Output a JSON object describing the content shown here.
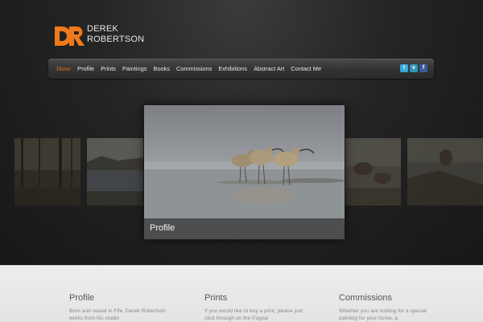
{
  "logo": {
    "line1": "DEREK",
    "line2": "ROBERTSON",
    "mark_color": "#f07a1b"
  },
  "nav": {
    "items": [
      {
        "label": "Home",
        "active": true
      },
      {
        "label": "Profile"
      },
      {
        "label": "Prints"
      },
      {
        "label": "Paintings"
      },
      {
        "label": "Books"
      },
      {
        "label": "Commissions"
      },
      {
        "label": "Exhibitions"
      },
      {
        "label": "Abstract Art"
      },
      {
        "label": "Contact Me"
      }
    ],
    "social": [
      {
        "icon": "twitter-icon",
        "glyph": "t"
      },
      {
        "icon": "vimeo-icon",
        "glyph": "v"
      },
      {
        "icon": "facebook-icon",
        "glyph": "f"
      }
    ],
    "active_color": "#f07a1b"
  },
  "slider": {
    "main_caption": "Profile"
  },
  "columns": [
    {
      "title": "Profile",
      "text": "Born and raised in Fife, Derek Robertson works from his studio"
    },
    {
      "title": "Prints",
      "text": "If you would like to buy a print, please just click through on the Paypal"
    },
    {
      "title": "Commissions",
      "text": "Whether you are looking for a special painting for your home, a"
    }
  ]
}
